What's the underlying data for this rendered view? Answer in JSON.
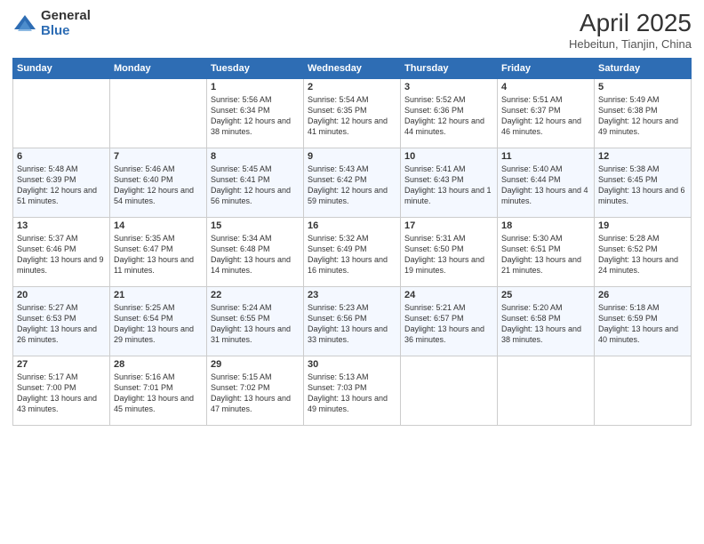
{
  "logo": {
    "general": "General",
    "blue": "Blue"
  },
  "header": {
    "month": "April 2025",
    "location": "Hebeitun, Tianjin, China"
  },
  "weekdays": [
    "Sunday",
    "Monday",
    "Tuesday",
    "Wednesday",
    "Thursday",
    "Friday",
    "Saturday"
  ],
  "weeks": [
    [
      {
        "day": "",
        "sunrise": "",
        "sunset": "",
        "daylight": ""
      },
      {
        "day": "",
        "sunrise": "",
        "sunset": "",
        "daylight": ""
      },
      {
        "day": "1",
        "sunrise": "Sunrise: 5:56 AM",
        "sunset": "Sunset: 6:34 PM",
        "daylight": "Daylight: 12 hours and 38 minutes."
      },
      {
        "day": "2",
        "sunrise": "Sunrise: 5:54 AM",
        "sunset": "Sunset: 6:35 PM",
        "daylight": "Daylight: 12 hours and 41 minutes."
      },
      {
        "day": "3",
        "sunrise": "Sunrise: 5:52 AM",
        "sunset": "Sunset: 6:36 PM",
        "daylight": "Daylight: 12 hours and 44 minutes."
      },
      {
        "day": "4",
        "sunrise": "Sunrise: 5:51 AM",
        "sunset": "Sunset: 6:37 PM",
        "daylight": "Daylight: 12 hours and 46 minutes."
      },
      {
        "day": "5",
        "sunrise": "Sunrise: 5:49 AM",
        "sunset": "Sunset: 6:38 PM",
        "daylight": "Daylight: 12 hours and 49 minutes."
      }
    ],
    [
      {
        "day": "6",
        "sunrise": "Sunrise: 5:48 AM",
        "sunset": "Sunset: 6:39 PM",
        "daylight": "Daylight: 12 hours and 51 minutes."
      },
      {
        "day": "7",
        "sunrise": "Sunrise: 5:46 AM",
        "sunset": "Sunset: 6:40 PM",
        "daylight": "Daylight: 12 hours and 54 minutes."
      },
      {
        "day": "8",
        "sunrise": "Sunrise: 5:45 AM",
        "sunset": "Sunset: 6:41 PM",
        "daylight": "Daylight: 12 hours and 56 minutes."
      },
      {
        "day": "9",
        "sunrise": "Sunrise: 5:43 AM",
        "sunset": "Sunset: 6:42 PM",
        "daylight": "Daylight: 12 hours and 59 minutes."
      },
      {
        "day": "10",
        "sunrise": "Sunrise: 5:41 AM",
        "sunset": "Sunset: 6:43 PM",
        "daylight": "Daylight: 13 hours and 1 minute."
      },
      {
        "day": "11",
        "sunrise": "Sunrise: 5:40 AM",
        "sunset": "Sunset: 6:44 PM",
        "daylight": "Daylight: 13 hours and 4 minutes."
      },
      {
        "day": "12",
        "sunrise": "Sunrise: 5:38 AM",
        "sunset": "Sunset: 6:45 PM",
        "daylight": "Daylight: 13 hours and 6 minutes."
      }
    ],
    [
      {
        "day": "13",
        "sunrise": "Sunrise: 5:37 AM",
        "sunset": "Sunset: 6:46 PM",
        "daylight": "Daylight: 13 hours and 9 minutes."
      },
      {
        "day": "14",
        "sunrise": "Sunrise: 5:35 AM",
        "sunset": "Sunset: 6:47 PM",
        "daylight": "Daylight: 13 hours and 11 minutes."
      },
      {
        "day": "15",
        "sunrise": "Sunrise: 5:34 AM",
        "sunset": "Sunset: 6:48 PM",
        "daylight": "Daylight: 13 hours and 14 minutes."
      },
      {
        "day": "16",
        "sunrise": "Sunrise: 5:32 AM",
        "sunset": "Sunset: 6:49 PM",
        "daylight": "Daylight: 13 hours and 16 minutes."
      },
      {
        "day": "17",
        "sunrise": "Sunrise: 5:31 AM",
        "sunset": "Sunset: 6:50 PM",
        "daylight": "Daylight: 13 hours and 19 minutes."
      },
      {
        "day": "18",
        "sunrise": "Sunrise: 5:30 AM",
        "sunset": "Sunset: 6:51 PM",
        "daylight": "Daylight: 13 hours and 21 minutes."
      },
      {
        "day": "19",
        "sunrise": "Sunrise: 5:28 AM",
        "sunset": "Sunset: 6:52 PM",
        "daylight": "Daylight: 13 hours and 24 minutes."
      }
    ],
    [
      {
        "day": "20",
        "sunrise": "Sunrise: 5:27 AM",
        "sunset": "Sunset: 6:53 PM",
        "daylight": "Daylight: 13 hours and 26 minutes."
      },
      {
        "day": "21",
        "sunrise": "Sunrise: 5:25 AM",
        "sunset": "Sunset: 6:54 PM",
        "daylight": "Daylight: 13 hours and 29 minutes."
      },
      {
        "day": "22",
        "sunrise": "Sunrise: 5:24 AM",
        "sunset": "Sunset: 6:55 PM",
        "daylight": "Daylight: 13 hours and 31 minutes."
      },
      {
        "day": "23",
        "sunrise": "Sunrise: 5:23 AM",
        "sunset": "Sunset: 6:56 PM",
        "daylight": "Daylight: 13 hours and 33 minutes."
      },
      {
        "day": "24",
        "sunrise": "Sunrise: 5:21 AM",
        "sunset": "Sunset: 6:57 PM",
        "daylight": "Daylight: 13 hours and 36 minutes."
      },
      {
        "day": "25",
        "sunrise": "Sunrise: 5:20 AM",
        "sunset": "Sunset: 6:58 PM",
        "daylight": "Daylight: 13 hours and 38 minutes."
      },
      {
        "day": "26",
        "sunrise": "Sunrise: 5:18 AM",
        "sunset": "Sunset: 6:59 PM",
        "daylight": "Daylight: 13 hours and 40 minutes."
      }
    ],
    [
      {
        "day": "27",
        "sunrise": "Sunrise: 5:17 AM",
        "sunset": "Sunset: 7:00 PM",
        "daylight": "Daylight: 13 hours and 43 minutes."
      },
      {
        "day": "28",
        "sunrise": "Sunrise: 5:16 AM",
        "sunset": "Sunset: 7:01 PM",
        "daylight": "Daylight: 13 hours and 45 minutes."
      },
      {
        "day": "29",
        "sunrise": "Sunrise: 5:15 AM",
        "sunset": "Sunset: 7:02 PM",
        "daylight": "Daylight: 13 hours and 47 minutes."
      },
      {
        "day": "30",
        "sunrise": "Sunrise: 5:13 AM",
        "sunset": "Sunset: 7:03 PM",
        "daylight": "Daylight: 13 hours and 49 minutes."
      },
      {
        "day": "",
        "sunrise": "",
        "sunset": "",
        "daylight": ""
      },
      {
        "day": "",
        "sunrise": "",
        "sunset": "",
        "daylight": ""
      },
      {
        "day": "",
        "sunrise": "",
        "sunset": "",
        "daylight": ""
      }
    ]
  ]
}
